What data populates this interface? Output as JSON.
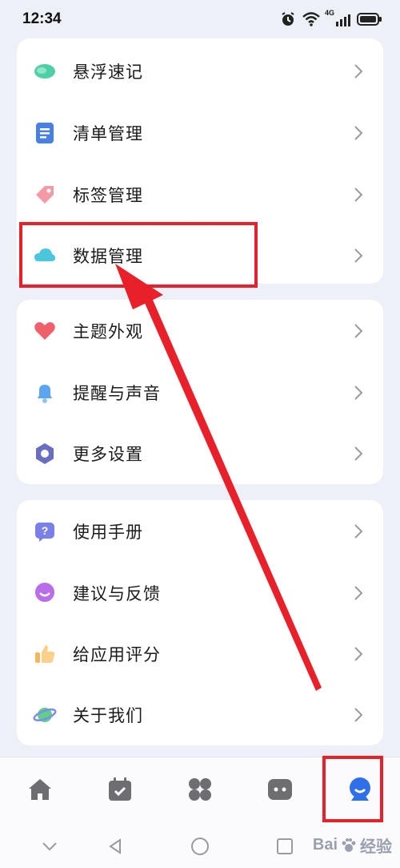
{
  "status_bar": {
    "time": "12:34",
    "icons": [
      "alarm-icon",
      "wifi-icon",
      "4g-signal-icon",
      "battery-icon"
    ],
    "network_label": "4G"
  },
  "groups": [
    {
      "items": [
        {
          "label": "悬浮速记",
          "icon": "floating-note-icon"
        },
        {
          "label": "清单管理",
          "icon": "list-icon"
        },
        {
          "label": "标签管理",
          "icon": "tag-icon"
        },
        {
          "label": "数据管理",
          "icon": "cloud-icon"
        }
      ]
    },
    {
      "items": [
        {
          "label": "主题外观",
          "icon": "heart-icon"
        },
        {
          "label": "提醒与声音",
          "icon": "bell-icon"
        },
        {
          "label": "更多设置",
          "icon": "hexagon-settings-icon"
        }
      ]
    },
    {
      "items": [
        {
          "label": "使用手册",
          "icon": "help-icon"
        },
        {
          "label": "建议与反馈",
          "icon": "feedback-icon"
        },
        {
          "label": "给应用评分",
          "icon": "thumbs-up-icon"
        },
        {
          "label": "关于我们",
          "icon": "planet-icon"
        }
      ]
    }
  ],
  "bottom_nav": [
    "home-icon",
    "calendar-icon",
    "apps-icon",
    "chat-icon",
    "profile-icon"
  ],
  "system_nav": [
    "collapse-icon",
    "back-icon",
    "home-circle-icon",
    "recents-icon"
  ],
  "watermark": {
    "brand": "Bai",
    "suffix": "经验"
  },
  "colors": {
    "accent": "#2f6fea",
    "annotation": "#e8202a",
    "background": "#eef0f8"
  }
}
